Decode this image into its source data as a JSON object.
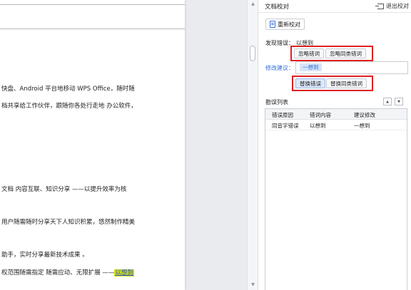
{
  "document": {
    "lines": [
      "快盘、Android 平台地移动 WPS Office，随时随",
      "档共享给工作伙伴，跟随你各处行走地  办公软件，",
      "文档  内容互联、知识分享  ——以提升效率为核",
      "用户随需随时分享天下人知识积累，悠然制作精美",
      "助手，实时分享最新技术成果  。",
      "权范围随需指定  随需应动、无限扩展  ——"
    ],
    "highlighted_word": "以想到"
  },
  "panel": {
    "title": "文档校对",
    "exit_label": "退出校对",
    "recheck_label": "重新校对",
    "found_error_label": "发现错误：",
    "found_error_value": "以想到",
    "ignore_label": "忽略错词",
    "ignore_same_label": "忽略同类错词",
    "suggest_label": "修改建议：",
    "suggest_value": "一想到",
    "replace_label": "替换错误",
    "replace_same_label": "替换同类错词",
    "list_title": "勘误列表",
    "table": {
      "headers": [
        "错误原因",
        "错词内容",
        "建议修改"
      ],
      "rows": [
        [
          "同音字错误",
          "以想到",
          "一想到"
        ]
      ]
    }
  },
  "colors": {
    "accent": "#2f6fd6",
    "highlight_box": "#e02020",
    "text_highlight": "#d5de0e"
  }
}
